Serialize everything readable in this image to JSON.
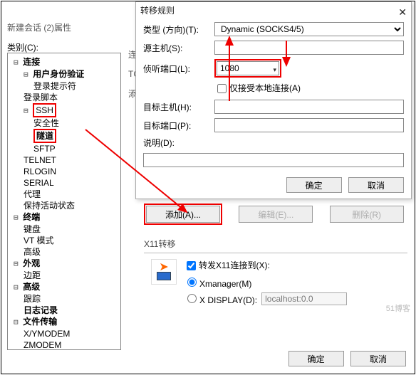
{
  "main": {
    "title": "新建会话 (2)属性",
    "cat_label": "类别(C):"
  },
  "tree": {
    "n0": "连接",
    "n1": "用户身份验证",
    "n2": "登录提示符",
    "n3": "登录脚本",
    "n4": "SSH",
    "n5": "安全性",
    "n6": "隧道",
    "n7": "SFTP",
    "n8": "TELNET",
    "n9": "RLOGIN",
    "n10": "SERIAL",
    "n11": "代理",
    "n12": "保持活动状态",
    "n13": "终端",
    "n14": "键盘",
    "n15": "VT 模式",
    "n16": "高级",
    "n17": "外观",
    "n18": "边距",
    "n19": "高级",
    "n20": "跟踪",
    "n21": "日志记录",
    "n22": "文件传输",
    "n23": "X/YMODEM",
    "n24": "ZMODEM"
  },
  "stub": {
    "l1": "连",
    "l2": "TC",
    "l3": "添"
  },
  "modal": {
    "title": "转移规则",
    "type_label": "类型 (方向)(T):",
    "type_value": "Dynamic (SOCKS4/5)",
    "src_host_label": "源主机(S):",
    "src_host_value": "",
    "listen_port_label": "侦听端口(L):",
    "listen_port_value": "1080",
    "local_only_label": "仅接受本地连接(A)",
    "dst_host_label": "目标主机(H):",
    "dst_host_value": "",
    "dst_port_label": "目标端口(P):",
    "dst_port_value": "",
    "desc_label": "说明(D):",
    "desc_value": "",
    "ok": "确定",
    "cancel": "取消"
  },
  "under": {
    "add": "添加(A)...",
    "edit": "编辑(E)...",
    "del": "删除(R)"
  },
  "x11": {
    "title": "X11转移",
    "forward_label": "转发X11连接到(X):",
    "opt_xmanager": "Xmanager(M)",
    "opt_display": "X DISPLAY(D):",
    "display_value": "localhost:0.0"
  },
  "footer": {
    "ok": "确定",
    "cancel": "取消"
  },
  "watermark": "51博客"
}
